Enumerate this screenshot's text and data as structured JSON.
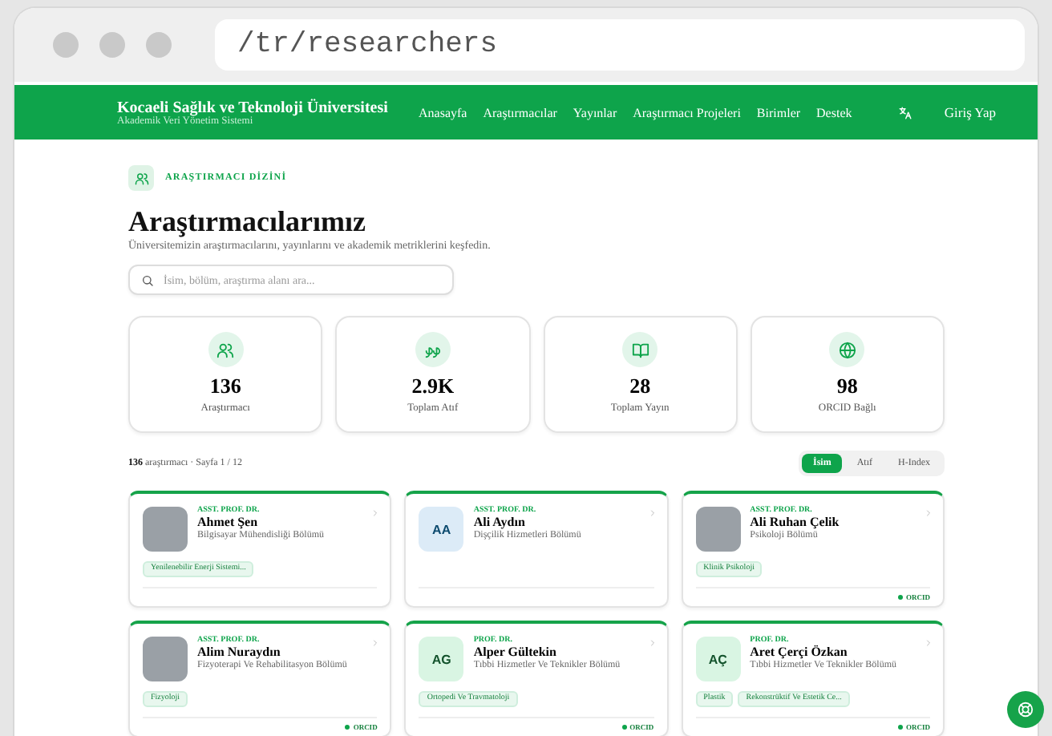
{
  "browser": {
    "url": "/tr/researchers"
  },
  "nav": {
    "brand": "Kocaeli Sağlık ve Teknoloji Üniversitesi",
    "subtitle": "Akademik Veri Yönetim Sistemi",
    "links": [
      "Anasayfa",
      "Araştırmacılar",
      "Yayınlar",
      "Araştırmacı Projeleri",
      "Birimler",
      "Destek"
    ],
    "login": "Giriş Yap"
  },
  "hero": {
    "badge": "ARAŞTIRMACI DİZİNİ",
    "title": "Araştırmacılarımız",
    "subtitle": "Üniversitemizin araştırmacılarını, yayınlarını ve akademik metriklerini keşfedin.",
    "search": {
      "placeholder": "İsim, bölüm, araştırma alanı ara..."
    }
  },
  "stats": [
    {
      "kind": "people",
      "value": "136",
      "label": "Araştırmacı"
    },
    {
      "kind": "quote",
      "value": "2.9K",
      "label": "Toplam Atıf"
    },
    {
      "kind": "book",
      "value": "28",
      "label": "Toplam Yayın"
    },
    {
      "kind": "globe",
      "value": "98",
      "label": "ORCID Bağlı"
    }
  ],
  "results": {
    "summary": "**136** araştırmacı · Sayfa 1 / 12",
    "sort": [
      {
        "label": "İsim",
        "selected": true
      },
      {
        "label": "Atıf",
        "selected": false
      },
      {
        "label": "H-Index",
        "selected": false
      }
    ]
  },
  "researchers": [
    {
      "avatar": {
        "kind": "photo"
      },
      "title": "ASST. PROF. DR.",
      "name": "Ahmet Şen",
      "department": "Bilgisayar Mühendisliği Bölümü",
      "tags": [
        "Yenilenebilir Enerji Sistemi..."
      ]
    },
    {
      "avatar": {
        "kind": "initials",
        "initials": "AA",
        "color": "#dcebf7"
      },
      "title": "ASST. PROF. DR.",
      "name": "Ali Aydın",
      "department": "Dişçilik Hizmetleri Bölümü"
    },
    {
      "avatar": {
        "kind": "photo"
      },
      "title": "ASST. PROF. DR.",
      "name": "Ali Ruhan Çelik",
      "department": "Psikoloji Bölümü",
      "tags": [
        "Klinik Psikoloji"
      ],
      "orcid": "ORCID"
    },
    {
      "avatar": {
        "kind": "photo"
      },
      "title": "ASST. PROF. DR.",
      "name": "Alim Nuraydın",
      "department": "Fizyoterapi Ve Rehabilitasyon Bölümü",
      "tags": [
        "Fizyoloji"
      ],
      "orcid": "ORCID"
    },
    {
      "avatar": {
        "kind": "initials",
        "initials": "AG",
        "color": "#d9f5e3"
      },
      "title": "PROF. DR.",
      "name": "Alper Gültekin",
      "department": "Tıbbi Hizmetler Ve Teknikler Bölümü",
      "tags": [
        "Ortopedi Ve Travmatoloji"
      ],
      "orcid": "ORCID"
    },
    {
      "avatar": {
        "kind": "initials",
        "initials": "AÇ",
        "color": "#d9f5e3"
      },
      "title": "PROF. DR.",
      "name": "Aret Çerçi Özkan",
      "department": "Tıbbi Hizmetler Ve Teknikler Bölümü",
      "tags": [
        "Plastik",
        "Rekonstrüktif Ve Estetik Ce..."
      ],
      "orcid": "ORCID"
    }
  ]
}
